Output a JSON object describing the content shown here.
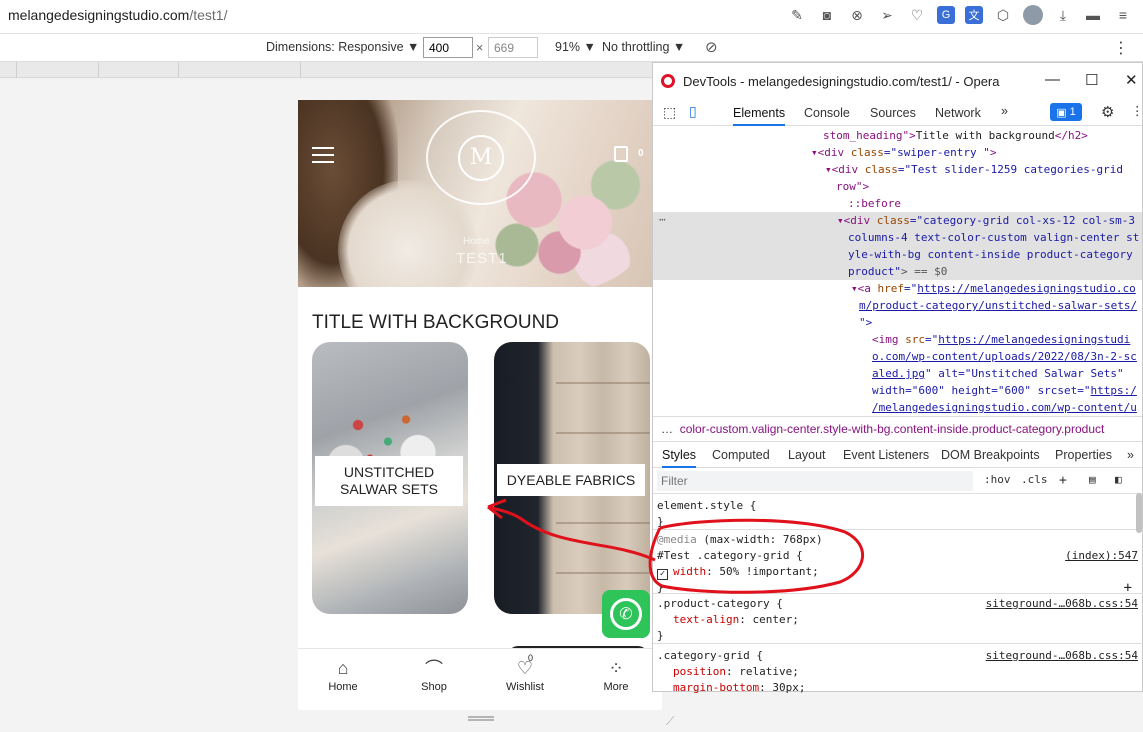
{
  "browser": {
    "url_host": "melangedesigningstudio.com",
    "url_path": "/test1/"
  },
  "device_toolbar": {
    "dimensions_label": "Dimensions: Responsive",
    "width_value": "400",
    "height_value": "669",
    "times": "×",
    "zoom": "91%",
    "throttling": "No throttling"
  },
  "page": {
    "hero_title": "TEST1",
    "hero_crumb": "Home",
    "logo_letter": "M",
    "cart_count": "0",
    "section_title": "TITLE WITH BACKGROUND",
    "cards": [
      {
        "label_line1": "UNSTITCHED",
        "label_line2": "SALWAR SETS"
      },
      {
        "label_line1": "DYEABLE FABRICS"
      }
    ],
    "whatsapp_glyph": "✆",
    "nav": [
      {
        "label": "Home",
        "icon": "home-icon",
        "glyph": "⌂"
      },
      {
        "label": "Shop",
        "icon": "hanger-icon",
        "glyph": "⌒"
      },
      {
        "label": "Wishlist",
        "icon": "heart-icon",
        "glyph": "♡",
        "badge": "0"
      },
      {
        "label": "More",
        "icon": "dots-icon",
        "glyph": "⁘"
      }
    ]
  },
  "devtools": {
    "window_title": "DevTools - melangedesigningstudio.com/test1/ - Opera",
    "tabs": [
      "Elements",
      "Console",
      "Sources",
      "Network"
    ],
    "active_tab": "Elements",
    "message_count": "1",
    "dom_lines": [
      {
        "t1": "stom_heading\">",
        "t2": "Title with background",
        "t3": "</h2>"
      },
      {
        "t1": "<div ",
        "a1": "class",
        "v1": "=\"swiper-entry \"",
        "t3": ">"
      },
      {
        "t1": "<div ",
        "a1": "class",
        "v1": "=\"Test slider-1259 categories-grid"
      },
      {
        "t1": "row\">"
      },
      {
        "t1": "::before"
      },
      {
        "t1": "<div ",
        "a1": "class",
        "v1": "=\"category-grid col-xs-12 col-sm-3"
      },
      {
        "v1": "columns-4 text-color-custom valign-center st"
      },
      {
        "v1": "yle-with-bg content-inside product-category"
      },
      {
        "v1": "product\"",
        "t3": "> == $0"
      },
      {
        "t1": "<a ",
        "a1": "href",
        "v1": "=\"",
        "l1": "https://melangedesigningstudio.co"
      },
      {
        "l1": "m/product-category/unstitched-salwar-sets/"
      },
      {
        "t1": "\">"
      },
      {
        "t1": "<img ",
        "a1": "src",
        "v1": "=\"",
        "l1": "https://melangedesigningstudi"
      },
      {
        "l1": "o.com/wp-content/uploads/2022/08/3n-2-sc"
      },
      {
        "l1": "aled.jpg",
        "v1": "\" alt=\"Unstitched Salwar Sets\""
      },
      {
        "v1": "width=\"600\" height=\"600\" srcset=\"",
        "l1": "https:/"
      },
      {
        "l1": "/melangedesigningstudio.com/wp-content/u"
      }
    ],
    "breadcrumb": "color-custom.valign-center.style-with-bg.content-inside.product-category.product",
    "sub_tabs": [
      "Styles",
      "Computed",
      "Layout",
      "Event Listeners",
      "DOM Breakpoints",
      "Properties"
    ],
    "filter_placeholder": "Filter",
    "hov": ":hov",
    "cls": ".cls",
    "rules": {
      "element_style": "element.style {",
      "media_kw": "@media",
      "media_query": "(max-width: 768px)",
      "test_selector": "#Test .category-grid {",
      "test_src": "(index):547",
      "test_prop": "width",
      "test_value": ": 50% !important;",
      "pc_selector": ".product-category {",
      "pc_src": "siteground-…068b.css:54",
      "pc_prop": "text-align",
      "pc_value": ": center;",
      "cg_selector": ".category-grid {",
      "cg_src": "siteground-…068b.css:54",
      "cg_prop1": "position",
      "cg_value1": ": relative;",
      "cg_prop2": "margin-bottom",
      "cg_value2": ": 30px;",
      "close": "}"
    }
  },
  "colors": {
    "accent": "#1a73e8",
    "annotation": "#e0111b",
    "whatsapp": "#2ec45a"
  }
}
